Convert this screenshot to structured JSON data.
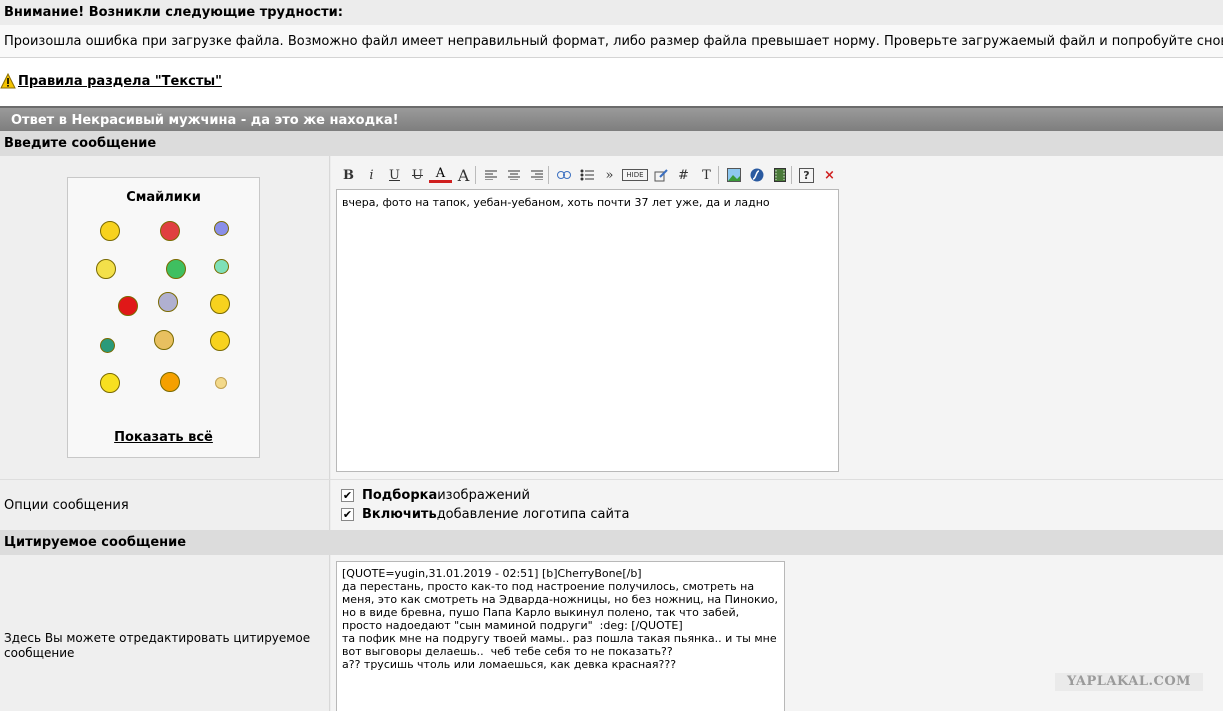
{
  "warning": {
    "title": "Внимание! Возникли следующие трудности:",
    "message": "Произошла ошибка при загрузке файла. Возможно файл имеет неправильный формат, либо размер файла превышает норму. Проверьте загружаемый файл и попробуйте снова."
  },
  "rules_link": "Правила раздела \"Тексты\"",
  "reply_title": "Ответ в Некрасивый мужчина - да это же находка!",
  "message_section": {
    "heading": "Введите сообщение",
    "smileys_title": "Смайлики",
    "show_all": "Показать всё",
    "editor_text": "вчера, фото на тапок, уебан-уебаном, хоть почти 37 лет уже, да и ладно"
  },
  "toolbar": {
    "bold": "B",
    "italic": "i",
    "underline": "U",
    "strike": "U",
    "color": "A",
    "size": "A",
    "more": "»",
    "hide": "HIDE",
    "hash": "#",
    "text": "T",
    "help": "?",
    "close": "×"
  },
  "options": {
    "label": "Опции сообщения",
    "items": [
      {
        "bold": "Подборка",
        "rest": " изображений",
        "checked": true
      },
      {
        "bold": "Включить",
        "rest": " добавление логотипа сайта",
        "checked": true
      }
    ]
  },
  "quote_section": {
    "heading": "Цитируемое сообщение",
    "label": "Здесь Вы можете отредактировать цитируемое сообщение",
    "text": "[QUOTE=yugin,31.01.2019 - 02:51] [b]CherryBone[/b]\nда перестань, просто как-то под настроение получилось, смотреть на\nменя, это как смотреть на Эдварда-ножницы, но без ножниц, на Пинокио,\nно в виде бревна, пушо Папа Карло выкинул полено, так что забей,\nпросто надоедают \"сын маминой подруги\"  :deg: [/QUOTE]\nта пофик мне на подругу твоей мамы.. раз пошла такая пьянка.. и ты мне\nвот выговоры делаешь..  чеб тебе себя то не показать??\nа?? трусишь чтоль или ломаешься, как девка красная???"
  },
  "watermark": "YAPLAKAL.COM"
}
